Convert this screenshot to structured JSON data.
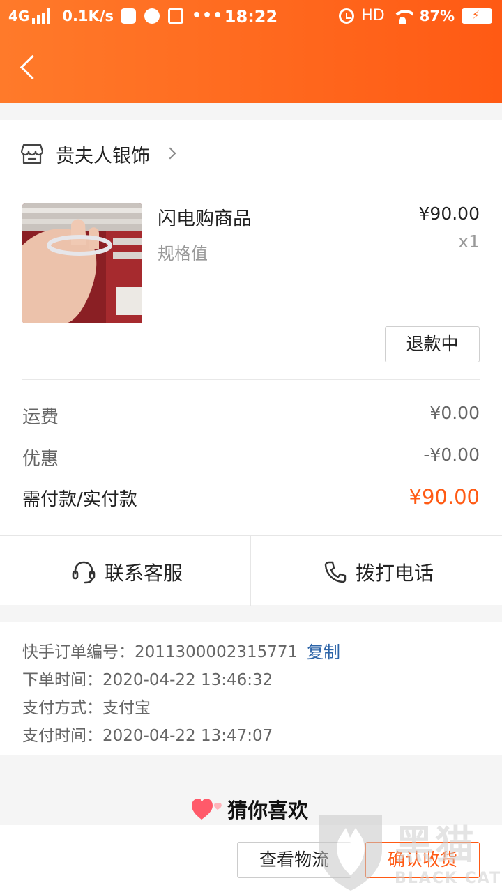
{
  "status_bar": {
    "network": "4G",
    "speed": "0.1K/s",
    "more": "•••",
    "time": "18:22",
    "hd": "HD",
    "battery": "87%"
  },
  "shop": {
    "name": "贵夫人银饰"
  },
  "product": {
    "name": "闪电购商品",
    "spec": "规格值",
    "price": "¥90.00",
    "quantity": "x1",
    "status_button": "退款中"
  },
  "fees": [
    {
      "label": "运费",
      "value": "¥0.00"
    },
    {
      "label": "优惠",
      "value": "-¥0.00"
    },
    {
      "label": "需付款/实付款",
      "value": "¥90.00"
    }
  ],
  "contact": {
    "service_label": "联系客服",
    "phone_label": "拨打电话"
  },
  "order_info": {
    "order_no_label": "快手订单编号：",
    "order_no": "2011300002315771",
    "copy_label": "复制",
    "order_time_label": "下单时间：",
    "order_time": "2020-04-22 13:46:32",
    "pay_method_label": "支付方式：",
    "pay_method": "支付宝",
    "pay_time_label": "支付时间：",
    "pay_time": "2020-04-22 13:47:07"
  },
  "recommend": {
    "title": "猜你喜欢"
  },
  "actions": {
    "logistics": "查看物流",
    "confirm": "确认收货"
  },
  "watermark": {
    "cn": "黑猫",
    "en": "BLACK CAT"
  },
  "colors": {
    "accent": "#ff5a14",
    "header_start": "#ff7a2a",
    "link": "#2c64a8"
  }
}
